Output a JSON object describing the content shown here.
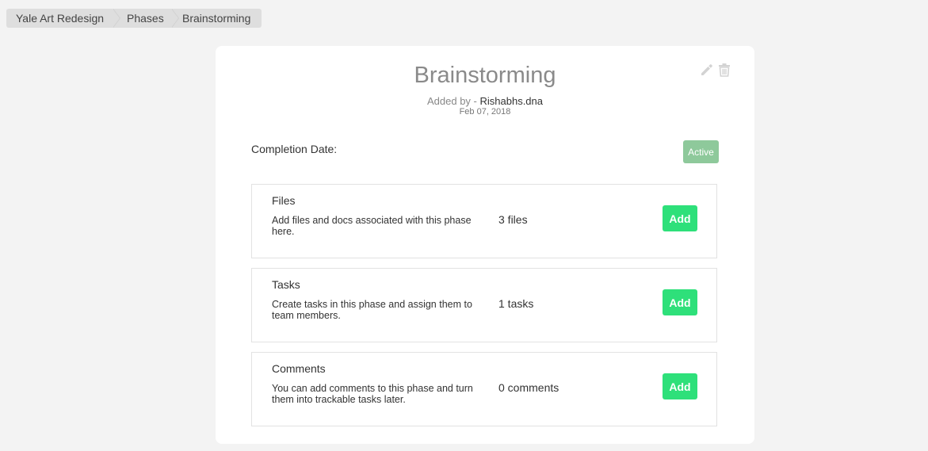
{
  "breadcrumb": {
    "items": [
      {
        "label": "Yale Art Redesign"
      },
      {
        "label": "Phases"
      },
      {
        "label": "Brainstorming"
      }
    ]
  },
  "phase": {
    "title": "Brainstorming",
    "added_by_prefix": "Added by - ",
    "author": "Rishabhs.dna",
    "date": "Feb 07, 2018",
    "completion_label": "Completion Date:",
    "status": "Active",
    "status_color": "#8ec99b",
    "actions": [
      {
        "icon": "pencil-icon"
      },
      {
        "icon": "trash-icon"
      }
    ]
  },
  "sections": [
    {
      "title": "Files",
      "description": "Add files and docs associated with this phase here.",
      "count": "3 files",
      "add_label": "Add"
    },
    {
      "title": "Tasks",
      "description": "Create tasks in this phase and assign them to team members.",
      "count": "1 tasks",
      "add_label": "Add"
    },
    {
      "title": "Comments",
      "description": "You can add comments to this phase and turn them into trackable tasks later.",
      "count": "0 comments",
      "add_label": "Add"
    }
  ],
  "colors": {
    "accent": "#2ee07a",
    "background": "#f3f3f3"
  }
}
